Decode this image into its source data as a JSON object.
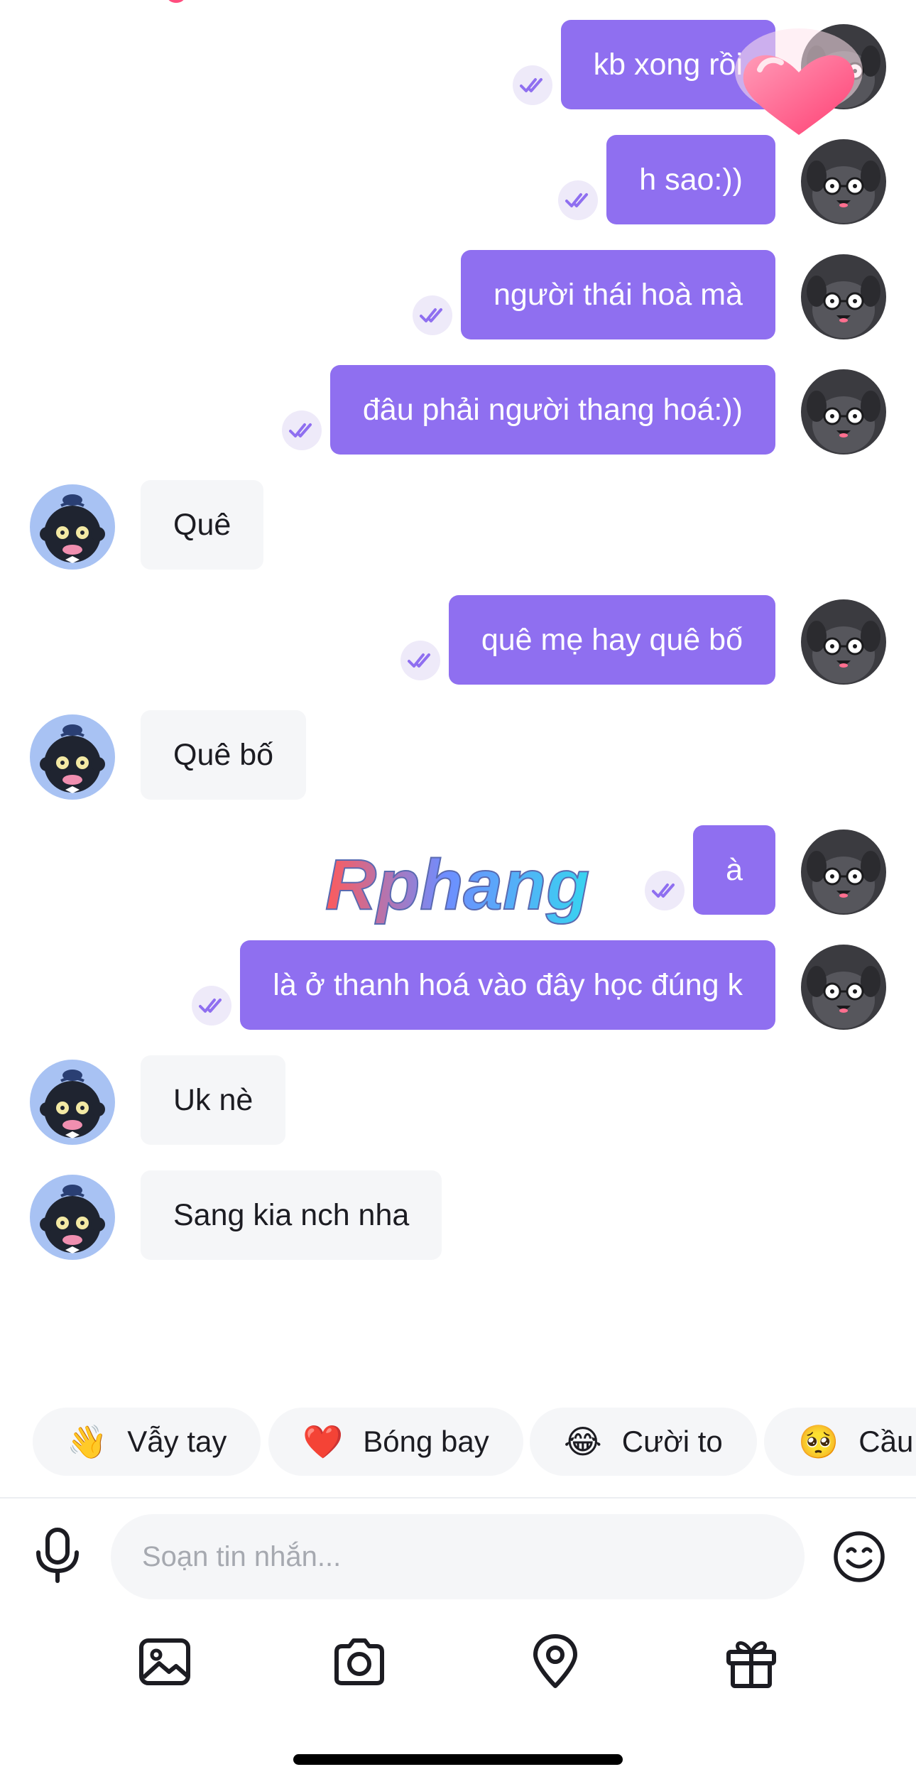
{
  "messages": [
    {
      "side": "out",
      "text": "kb xong rồi"
    },
    {
      "side": "out",
      "text": "h sao:))"
    },
    {
      "side": "out",
      "text": "người thái hoà mà"
    },
    {
      "side": "out",
      "text": "đâu phải người thang hoá:))"
    },
    {
      "side": "in",
      "text": "Quê"
    },
    {
      "side": "out",
      "text": "quê mẹ hay quê bố"
    },
    {
      "side": "in",
      "text": "Quê bố"
    },
    {
      "side": "out",
      "text": "à"
    },
    {
      "side": "out",
      "text": "là ở thanh hoá vào đây học đúng k"
    },
    {
      "side": "in",
      "text": "Uk nè"
    },
    {
      "side": "in",
      "text": "Sang kia nch nha"
    }
  ],
  "watermark": "Rphang",
  "quick_reactions": [
    {
      "emoji": "👋",
      "label": "Vẫy tay"
    },
    {
      "emoji": "❤️",
      "label": "Bóng bay"
    },
    {
      "emoji": "😂",
      "label": "Cười to"
    },
    {
      "emoji": "🥺",
      "label": "Cầu"
    }
  ],
  "composer": {
    "placeholder": "Soạn tin nhắn..."
  },
  "icons": {
    "mic": "microphone-icon",
    "emoji": "smiley-icon",
    "tools": [
      "image-icon",
      "camera-icon",
      "location-pin-icon",
      "gift-icon"
    ]
  },
  "colors": {
    "accent": "#8f6ff0",
    "incoming_bubble": "#f5f6f8",
    "seen_check": "#8f6ff0"
  }
}
